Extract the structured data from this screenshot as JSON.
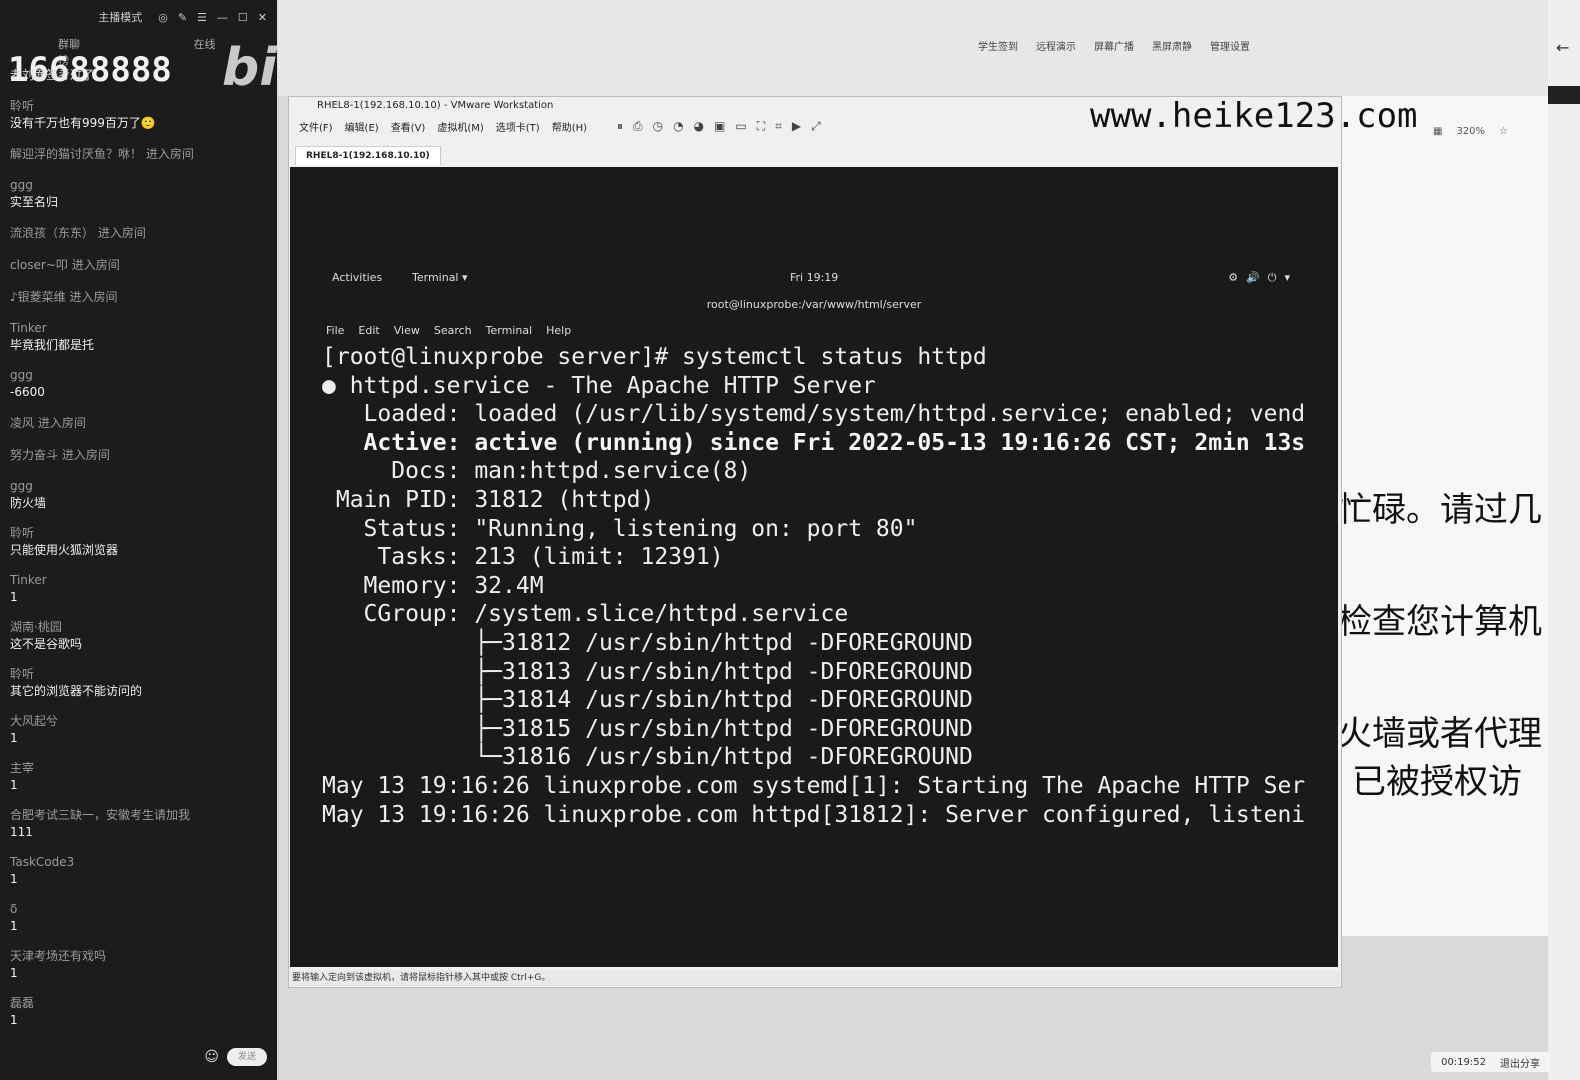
{
  "chat": {
    "top_mode": "主播模式",
    "tabs": [
      "群聊",
      "在线榜"
    ],
    "watermark_number": "16688888",
    "watermark_logo": "bilibili",
    "header_user": "老刘面签考过了",
    "messages": [
      {
        "user": "聆听",
        "text": "没有千万也有999百万了🙂"
      },
      {
        "system": "解迎浮的猫讨厌鱼？咻！ 进入房间"
      },
      {
        "user": "ggg",
        "text": "实至名归"
      },
      {
        "system": "流浪孩（东东） 进入房间"
      },
      {
        "system": "closer~叩  进入房间"
      },
      {
        "system": "♪银菱菜维 进入房间"
      },
      {
        "user": "Tinker",
        "text": "毕竟我们都是托"
      },
      {
        "user": "ggg",
        "text": "-6600"
      },
      {
        "system": "凌风 进入房间"
      },
      {
        "system": "努力奋斗 进入房间"
      },
      {
        "user": "ggg",
        "text": "防火墙"
      },
      {
        "user": "聆听",
        "text": "只能使用火狐浏览器"
      },
      {
        "user": "Tinker",
        "text": "1"
      },
      {
        "user": "湖南·桃园",
        "text": "这不是谷歌吗"
      },
      {
        "user": "聆听",
        "text": "其它的浏览器不能访问的"
      },
      {
        "user": "大风起兮",
        "text": "1"
      },
      {
        "user": "主宰",
        "text": "1"
      },
      {
        "user": "合肥考试三缺一，安徽考生请加我",
        "text": "111"
      },
      {
        "user": "TaskCode3",
        "text": "1"
      },
      {
        "user": "δ",
        "text": "1"
      },
      {
        "user": "天津考场还有戏吗",
        "text": "1"
      },
      {
        "user": "磊磊",
        "text": "1"
      }
    ],
    "send_label": "发送"
  },
  "top_tools": [
    "学生签到",
    "远程演示",
    "屏幕广播",
    "黑屏肃静",
    "管理设置"
  ],
  "vm": {
    "title": "RHEL8-1(192.168.10.10) - VMware Workstation",
    "menu": [
      "文件(F)",
      "编辑(E)",
      "查看(V)",
      "虚拟机(M)",
      "选项卡(T)",
      "帮助(H)"
    ],
    "tab": "RHEL8-1(192.168.10.10)",
    "status_hint": "要将输入定向到该虚拟机，请将鼠标指针移入其中或按 Ctrl+G。"
  },
  "site_watermark": "www.heike123.com",
  "gnome": {
    "activities": "Activities",
    "app": "Terminal ▾",
    "clock": "Fri 19:19",
    "terminal_title": "root@linuxprobe:/var/www/html/server",
    "menu": [
      "File",
      "Edit",
      "View",
      "Search",
      "Terminal",
      "Help"
    ]
  },
  "terminal_lines": [
    "[root@linuxprobe server]# systemctl status httpd",
    "● httpd.service - The Apache HTTP Server",
    "   Loaded: loaded (/usr/lib/systemd/system/httpd.service; enabled; vend",
    "   Active: active (running) since Fri 2022-05-13 19:16:26 CST; 2min 13s",
    "     Docs: man:httpd.service(8)",
    " Main PID: 31812 (httpd)",
    "   Status: \"Running, listening on: port 80\"",
    "    Tasks: 213 (limit: 12391)",
    "   Memory: 32.4M",
    "   CGroup: /system.slice/httpd.service",
    "           ├─31812 /usr/sbin/httpd -DFOREGROUND",
    "           ├─31813 /usr/sbin/httpd -DFOREGROUND",
    "           ├─31814 /usr/sbin/httpd -DFOREGROUND",
    "           ├─31815 /usr/sbin/httpd -DFOREGROUND",
    "           └─31816 /usr/sbin/httpd -DFOREGROUND",
    "",
    "May 13 19:16:26 linuxprobe.com systemd[1]: Starting The Apache HTTP Ser",
    "May 13 19:16:26 linuxprobe.com httpd[31812]: Server configured, listeni"
  ],
  "right_browser": {
    "zoom": "320%",
    "text_lines": [
      "忙碌。请过几",
      "检查您计算机",
      "火墙或者代理",
      "已被授权访"
    ]
  },
  "share_bar": {
    "timer": "00:19:52",
    "exit_label": "退出分享"
  }
}
